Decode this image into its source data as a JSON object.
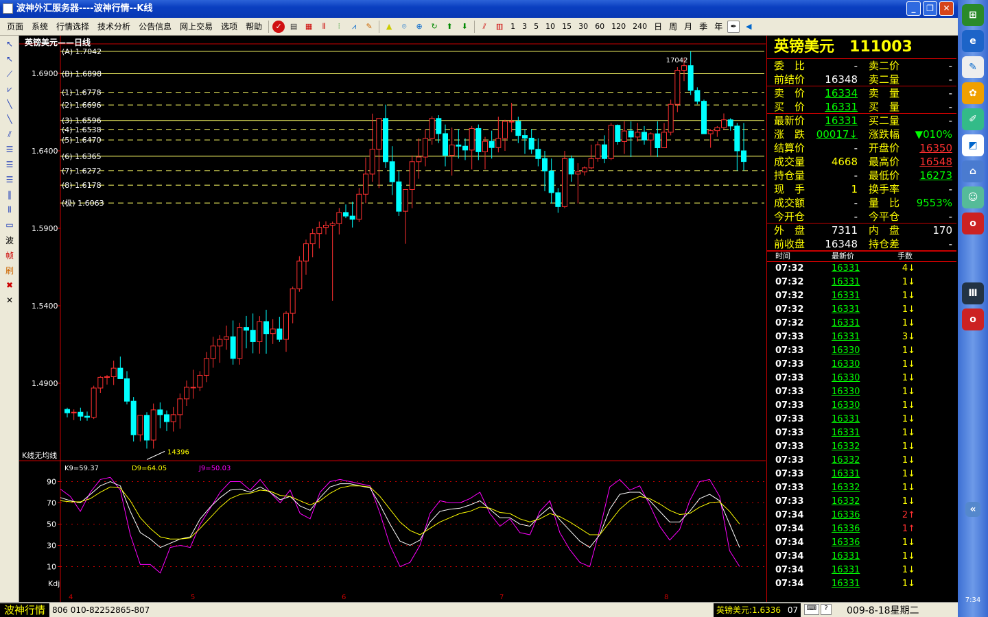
{
  "window": {
    "title": "波神外汇服务器----波神行情--K线"
  },
  "menu": [
    "页面",
    "系统",
    "行情选择",
    "技术分析",
    "公告信息",
    "网上交易",
    "选项",
    "帮助"
  ],
  "periods": [
    "1",
    "3",
    "5",
    "10",
    "15",
    "30",
    "60",
    "120",
    "240",
    "日",
    "周",
    "月",
    "季",
    "年"
  ],
  "left_tools": [
    "波",
    "帧",
    "刷"
  ],
  "chart": {
    "title": "英镑美元——日线",
    "price_axis": [
      "1.6900",
      "1.6400",
      "1.5900",
      "1.5400",
      "1.4900"
    ],
    "fib_lines": [
      {
        "label": "(A) 1.7042",
        "price": 1.7042
      },
      {
        "label": "(B) 1.6898",
        "price": 1.6898
      },
      {
        "label": "(1) 1.6778",
        "price": 1.6778
      },
      {
        "label": "(2) 1.6696",
        "price": 1.6696
      },
      {
        "label": "(3) 1.6596",
        "price": 1.6596
      },
      {
        "label": "(4) 1.6538",
        "price": 1.6538
      },
      {
        "label": "(5) 1.6470",
        "price": 1.647
      },
      {
        "label": "(6) 1.6365",
        "price": 1.6365
      },
      {
        "label": "(7) 1.6272",
        "price": 1.6272
      },
      {
        "label": "(8) 1.6178",
        "price": 1.6178
      },
      {
        "label": "(极) 1.6063",
        "price": 1.6063
      }
    ],
    "high_label": "17042",
    "low_label": "14396",
    "subtitle": "K线无均线",
    "kdj": {
      "k_label": "K9=59.37",
      "d_label": "D9=64.05",
      "j_label": "J9=50.03",
      "axis": [
        "90",
        "70",
        "50",
        "30",
        "10"
      ],
      "name": "Kdj"
    },
    "month_ticks": [
      "4",
      "5",
      "6",
      "7",
      "8"
    ]
  },
  "chart_data": {
    "type": "candlestick",
    "price_range": [
      1.4396,
      1.7042
    ],
    "candles_ohlc": [
      [
        1.4731,
        1.4742,
        1.468,
        1.4709
      ],
      [
        1.4709,
        1.4731,
        1.4662,
        1.4713
      ],
      [
        1.4713,
        1.4742,
        1.4658,
        1.4687
      ],
      [
        1.4687,
        1.4717,
        1.4658,
        1.468
      ],
      [
        1.468,
        1.4884,
        1.4669,
        1.4869
      ],
      [
        1.4869,
        1.4946,
        1.4838,
        1.4938
      ],
      [
        1.4938,
        1.4953,
        1.4891,
        1.4942
      ],
      [
        1.4942,
        1.5046,
        1.4888,
        1.4997
      ],
      [
        1.4997,
        1.5072,
        1.4929,
        1.4929
      ],
      [
        1.4929,
        1.4978,
        1.4764,
        1.4784
      ],
      [
        1.4784,
        1.4811,
        1.4524,
        1.4567
      ],
      [
        1.4567,
        1.4696,
        1.4524,
        1.4693
      ],
      [
        1.4693,
        1.4713,
        1.4478,
        1.4533
      ],
      [
        1.4533,
        1.4769,
        1.4478,
        1.4728
      ],
      [
        1.4728,
        1.4776,
        1.461,
        1.4697
      ],
      [
        1.4697,
        1.4724,
        1.4591,
        1.4652
      ],
      [
        1.4652,
        1.4746,
        1.4588,
        1.4697
      ],
      [
        1.4697,
        1.4834,
        1.4606,
        1.4799
      ],
      [
        1.4799,
        1.4917,
        1.4754,
        1.4874
      ],
      [
        1.4874,
        1.4987,
        1.48,
        1.4874
      ],
      [
        1.4874,
        1.4978,
        1.485,
        1.4951
      ],
      [
        1.4951,
        1.5102,
        1.4907,
        1.506
      ],
      [
        1.506,
        1.52,
        1.5,
        1.514
      ],
      [
        1.514,
        1.521,
        1.5032,
        1.5183
      ],
      [
        1.5183,
        1.5272,
        1.5116,
        1.52
      ],
      [
        1.52,
        1.5305,
        1.502,
        1.506
      ],
      [
        1.506,
        1.529,
        1.502,
        1.526
      ],
      [
        1.526,
        1.5334,
        1.5125,
        1.5242
      ],
      [
        1.5242,
        1.535,
        1.5093,
        1.5168
      ],
      [
        1.5168,
        1.5333,
        1.5091,
        1.5298
      ],
      [
        1.5298,
        1.5374,
        1.5091,
        1.522
      ],
      [
        1.522,
        1.5314,
        1.5153,
        1.525
      ],
      [
        1.525,
        1.5329,
        1.5166,
        1.5183
      ],
      [
        1.5183,
        1.5365,
        1.5103,
        1.5351
      ],
      [
        1.5351,
        1.5524,
        1.5287,
        1.551
      ],
      [
        1.551,
        1.572,
        1.549,
        1.5688
      ],
      [
        1.5688,
        1.5827,
        1.56,
        1.58
      ],
      [
        1.58,
        1.5897,
        1.5713,
        1.5866
      ],
      [
        1.5866,
        1.5943,
        1.577,
        1.5906
      ],
      [
        1.5906,
        1.5945,
        1.586,
        1.592
      ],
      [
        1.592,
        1.5943,
        1.5432,
        1.593
      ],
      [
        1.593,
        1.6031,
        1.586,
        1.6002
      ],
      [
        1.6002,
        1.6054,
        1.5966,
        1.5979
      ],
      [
        1.5979,
        1.6071,
        1.5905,
        1.5958
      ],
      [
        1.5958,
        1.616,
        1.594,
        1.612
      ],
      [
        1.612,
        1.6357,
        1.6062,
        1.625
      ],
      [
        1.625,
        1.664,
        1.62,
        1.641
      ],
      [
        1.641,
        1.659,
        1.616,
        1.6609
      ],
      [
        1.6609,
        1.6698,
        1.629,
        1.633
      ],
      [
        1.633,
        1.643,
        1.6115,
        1.62
      ],
      [
        1.62,
        1.627,
        1.598,
        1.601
      ],
      [
        1.601,
        1.615,
        1.58,
        1.615
      ],
      [
        1.615,
        1.637,
        1.603,
        1.633
      ],
      [
        1.633,
        1.648,
        1.622,
        1.636
      ],
      [
        1.636,
        1.654,
        1.63,
        1.648
      ],
      [
        1.648,
        1.6623,
        1.644,
        1.6609
      ],
      [
        1.6609,
        1.663,
        1.645,
        1.6511
      ],
      [
        1.6511,
        1.657,
        1.63,
        1.6371
      ],
      [
        1.6371,
        1.655,
        1.624,
        1.6438
      ],
      [
        1.6438,
        1.654,
        1.635,
        1.643
      ],
      [
        1.643,
        1.648,
        1.634,
        1.6405
      ],
      [
        1.6405,
        1.656,
        1.628,
        1.6544
      ],
      [
        1.6544,
        1.657,
        1.634,
        1.6394
      ],
      [
        1.6394,
        1.649,
        1.628,
        1.6461
      ],
      [
        1.6461,
        1.653,
        1.635,
        1.6421
      ],
      [
        1.6421,
        1.662,
        1.639,
        1.648
      ],
      [
        1.648,
        1.66,
        1.64,
        1.659
      ],
      [
        1.659,
        1.671,
        1.652,
        1.659
      ],
      [
        1.659,
        1.662,
        1.645,
        1.6499
      ],
      [
        1.6499,
        1.654,
        1.638,
        1.6482
      ],
      [
        1.6482,
        1.654,
        1.638,
        1.641
      ],
      [
        1.641,
        1.648,
        1.63,
        1.635
      ],
      [
        1.635,
        1.64,
        1.614,
        1.627
      ],
      [
        1.627,
        1.635,
        1.606,
        1.613
      ],
      [
        1.613,
        1.616,
        1.6,
        1.604
      ],
      [
        1.604,
        1.64,
        1.603,
        1.635
      ],
      [
        1.635,
        1.637,
        1.62,
        1.625
      ],
      [
        1.625,
        1.632,
        1.606,
        1.6264
      ],
      [
        1.6264,
        1.63,
        1.624,
        1.629
      ],
      [
        1.629,
        1.644,
        1.628,
        1.635
      ],
      [
        1.635,
        1.646,
        1.633,
        1.6439
      ],
      [
        1.6439,
        1.65,
        1.632,
        1.635
      ],
      [
        1.635,
        1.658,
        1.634,
        1.6565
      ],
      [
        1.6565,
        1.657,
        1.644,
        1.646
      ],
      [
        1.646,
        1.659,
        1.638,
        1.6528
      ],
      [
        1.6528,
        1.659,
        1.636,
        1.6489
      ],
      [
        1.6489,
        1.658,
        1.646,
        1.652
      ],
      [
        1.652,
        1.656,
        1.644,
        1.647
      ],
      [
        1.647,
        1.652,
        1.637,
        1.651
      ],
      [
        1.651,
        1.659,
        1.636,
        1.642
      ],
      [
        1.642,
        1.658,
        1.642,
        1.652
      ],
      [
        1.652,
        1.673,
        1.65,
        1.67
      ],
      [
        1.67,
        1.694,
        1.665,
        1.692
      ],
      [
        1.692,
        1.7,
        1.685,
        1.695
      ],
      [
        1.695,
        1.7042,
        1.676,
        1.679
      ],
      [
        1.679,
        1.681,
        1.67,
        1.672
      ],
      [
        1.672,
        1.673,
        1.652,
        1.651
      ],
      [
        1.651,
        1.654,
        1.642,
        1.653
      ],
      [
        1.653,
        1.656,
        1.649,
        1.655
      ],
      [
        1.655,
        1.6641,
        1.654,
        1.66
      ],
      [
        1.66,
        1.661,
        1.653,
        1.656
      ],
      [
        1.656,
        1.658,
        1.6273,
        1.64
      ],
      [
        1.64,
        1.658,
        1.6273,
        1.6331
      ]
    ],
    "kdj_series": {
      "J": [
        83,
        76,
        62,
        80,
        92,
        94,
        82,
        40,
        12,
        12,
        4,
        28,
        30,
        28,
        50,
        65,
        80,
        90,
        90,
        82,
        92,
        80,
        70,
        82,
        60,
        55,
        80,
        90,
        92,
        90,
        88,
        86,
        60,
        30,
        10,
        14,
        30,
        60,
        72,
        70,
        70,
        74,
        80,
        60,
        48,
        55,
        42,
        40,
        62,
        72,
        42,
        26,
        14,
        10,
        45,
        85,
        92,
        82,
        86,
        68,
        48,
        35,
        45,
        72,
        90,
        92,
        76,
        25,
        10
      ],
      "K": [
        75,
        72,
        70,
        78,
        86,
        90,
        86,
        62,
        42,
        36,
        28,
        32,
        36,
        38,
        55,
        66,
        75,
        82,
        83,
        80,
        85,
        80,
        73,
        76,
        67,
        63,
        75,
        85,
        88,
        88,
        86,
        84,
        68,
        50,
        34,
        30,
        35,
        52,
        62,
        64,
        65,
        68,
        72,
        64,
        56,
        56,
        50,
        48,
        58,
        66,
        54,
        44,
        34,
        28,
        40,
        64,
        78,
        80,
        80,
        72,
        62,
        52,
        52,
        62,
        74,
        78,
        72,
        50,
        28
      ],
      "D": [
        72,
        71,
        71,
        74,
        80,
        85,
        84,
        72,
        56,
        46,
        38,
        36,
        36,
        37,
        46,
        56,
        66,
        74,
        78,
        79,
        82,
        81,
        77,
        76,
        72,
        68,
        72,
        79,
        84,
        86,
        86,
        85,
        76,
        64,
        52,
        44,
        40,
        46,
        52,
        56,
        60,
        62,
        66,
        65,
        61,
        60,
        55,
        52,
        55,
        60,
        57,
        52,
        46,
        40,
        40,
        52,
        64,
        72,
        76,
        74,
        69,
        63,
        59,
        60,
        66,
        70,
        71,
        62,
        50
      ]
    },
    "kdj_ylim": [
      0,
      100
    ]
  },
  "quote": {
    "name": "英镑美元",
    "code": "111003",
    "rows": [
      [
        "委　比",
        "-",
        "卖二价",
        "-"
      ],
      [
        "前结价",
        "16348",
        "卖二量",
        "-"
      ],
      [
        "卖　价",
        "16334",
        "卖　量",
        "-"
      ],
      [
        "买　价",
        "16331",
        "买　量",
        "-"
      ],
      [
        "最新价",
        "16331",
        "买二量",
        "-"
      ],
      [
        "涨　跌",
        "00017↓",
        "涨跌幅",
        "▼010%"
      ],
      [
        "结算价",
        "-",
        "开盘价",
        "16350"
      ],
      [
        "成交量",
        "4668",
        "最高价",
        "16548"
      ],
      [
        "持仓量",
        "-",
        "最低价",
        "16273"
      ],
      [
        "现　手",
        "1",
        "换手率",
        "-"
      ],
      [
        "成交额",
        "-",
        "量　比",
        "9553%"
      ],
      [
        "今开仓",
        "-",
        "今平仓",
        "-"
      ],
      [
        "外　盘",
        "7311",
        "内　盘",
        "170"
      ],
      [
        "前收盘",
        "16348",
        "持仓差",
        "-"
      ]
    ],
    "ticks_header": [
      "时间",
      "最新价",
      "手数"
    ],
    "ticks": [
      [
        "07:32",
        "16331",
        "4↓"
      ],
      [
        "07:32",
        "16331",
        "1↓"
      ],
      [
        "07:32",
        "16331",
        "1↓"
      ],
      [
        "07:32",
        "16331",
        "1↓"
      ],
      [
        "07:32",
        "16331",
        "1↓"
      ],
      [
        "07:33",
        "16331",
        "3↓"
      ],
      [
        "07:33",
        "16330",
        "1↓"
      ],
      [
        "07:33",
        "16330",
        "1↓"
      ],
      [
        "07:33",
        "16330",
        "1↓"
      ],
      [
        "07:33",
        "16330",
        "1↓"
      ],
      [
        "07:33",
        "16330",
        "1↓"
      ],
      [
        "07:33",
        "16331",
        "1↓"
      ],
      [
        "07:33",
        "16331",
        "1↓"
      ],
      [
        "07:33",
        "16332",
        "1↓"
      ],
      [
        "07:33",
        "16332",
        "1↓"
      ],
      [
        "07:33",
        "16331",
        "1↓"
      ],
      [
        "07:33",
        "16332",
        "1↓"
      ],
      [
        "07:33",
        "16332",
        "1↓"
      ],
      [
        "07:34",
        "16336",
        "2↑"
      ],
      [
        "07:34",
        "16336",
        "1↑"
      ],
      [
        "07:34",
        "16336",
        "1↓"
      ],
      [
        "07:34",
        "16331",
        "1↓"
      ],
      [
        "07:34",
        "16331",
        "1↓"
      ],
      [
        "07:34",
        "16331",
        "1↓"
      ]
    ]
  },
  "statusbar": {
    "app": "波神行情",
    "phone": "806 010-82252865-807",
    "ticker": "英镑美元:1.6336",
    "prefix": "07",
    "date": "009-8-18星期二"
  },
  "tray": {
    "time": "7:34"
  }
}
